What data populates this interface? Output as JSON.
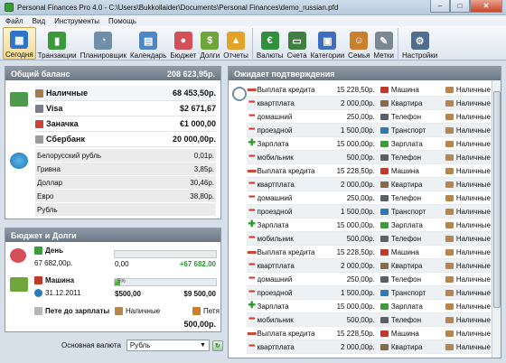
{
  "window": {
    "title": "Personal Finances Pro 4.0 - C:\\Users\\Bukkollaider\\Documents\\Personal Finances\\demo_russian.pfd"
  },
  "menu": [
    "Файл",
    "Вид",
    "Инструменты",
    "Помощь"
  ],
  "toolbar": [
    {
      "label": "Сегодня",
      "icon": "calendar-today-icon",
      "color": "#2f74c8"
    },
    {
      "label": "Транзакции",
      "icon": "book-icon",
      "color": "#3c9a3c"
    },
    {
      "label": "Планировщик",
      "icon": "clock-icon",
      "color": "#6f8fa8"
    },
    {
      "label": "Календарь",
      "icon": "calendar-icon",
      "color": "#4b86c6"
    },
    {
      "label": "Бюджет",
      "icon": "piggy-bank-icon",
      "color": "#d44f57"
    },
    {
      "label": "Долги",
      "icon": "money-stack-icon",
      "color": "#6fa63a"
    },
    {
      "label": "Отчеты",
      "icon": "chart-icon",
      "color": "#e3a228"
    },
    {
      "label": "Валюты",
      "icon": "currency-exchange-icon",
      "color": "#2f8f3a"
    },
    {
      "label": "Счета",
      "icon": "accounts-icon",
      "color": "#3f7f3f"
    },
    {
      "label": "Категории",
      "icon": "categories-icon",
      "color": "#3d6fc0"
    },
    {
      "label": "Семья",
      "icon": "family-icon",
      "color": "#c9802c"
    },
    {
      "label": "Метки",
      "icon": "tags-icon",
      "color": "#7c8794"
    },
    {
      "label": "Настройки",
      "icon": "settings-icon",
      "color": "#4f6d8f"
    }
  ],
  "balance": {
    "title": "Общий баланс",
    "total": "208 623,95р.",
    "accounts": [
      {
        "name": "Наличные",
        "value": "68 453,50р.",
        "color": "#a67a4a"
      },
      {
        "name": "Visa",
        "value": "$2 671,67",
        "color": "#7a7f87"
      },
      {
        "name": "Заначка",
        "value": "€1 000,00",
        "color": "#c9443a"
      },
      {
        "name": "Сбербанк",
        "value": "20 000,00р.",
        "color": "#9a9a9a"
      }
    ],
    "currencies": [
      {
        "name": "Белорусский рубль",
        "value": "0,01р."
      },
      {
        "name": "Гривна",
        "value": "3,85р."
      },
      {
        "name": "Доллар",
        "value": "30,46р."
      },
      {
        "name": "Евро",
        "value": "38,80р."
      },
      {
        "name": "Рубль",
        "value": ""
      }
    ]
  },
  "budget": {
    "title": "Бюджет и Долги",
    "day": {
      "label": "День",
      "amount": "67 682,00р.",
      "spent": "0,00",
      "remaining": "+67 682,00",
      "progress": 0
    },
    "car": {
      "label": "Машина",
      "date": "31.12.2011",
      "progress_text": "5%",
      "progress": 0.05,
      "current": "$500,00",
      "target": "$9 500,00"
    },
    "debt": {
      "label": "Пете до зарплаты",
      "account": "Наличные",
      "person": "Петя",
      "amount": "500,00р."
    }
  },
  "bottom": {
    "label": "Основная валюта",
    "currency": "Рубль"
  },
  "pending": {
    "title": "Ожидает подтверждения",
    "rows": [
      {
        "type": "credit",
        "name": "Выплата кредита",
        "amount": "15 228,50р.",
        "account": "Машина",
        "payment": "Наличные"
      },
      {
        "type": "minus",
        "name": "квартплата",
        "amount": "2 000,00р.",
        "account": "Квартира",
        "payment": "Наличные"
      },
      {
        "type": "minus",
        "name": "домашний",
        "amount": "250,00р.",
        "account": "Телефон",
        "payment": "Наличные"
      },
      {
        "type": "minus",
        "name": "проездной",
        "amount": "1 500,00р.",
        "account": "Транспорт",
        "payment": "Наличные"
      },
      {
        "type": "plus",
        "name": "Зарплата",
        "amount": "15 000,00р.",
        "account": "Зарплата",
        "payment": "Наличные"
      },
      {
        "type": "minus",
        "name": "мобильник",
        "amount": "500,00р.",
        "account": "Телефон",
        "payment": "Наличные"
      },
      {
        "type": "credit",
        "name": "Выплата кредита",
        "amount": "15 228,50р.",
        "account": "Машина",
        "payment": "Наличные"
      },
      {
        "type": "minus",
        "name": "квартплата",
        "amount": "2 000,00р.",
        "account": "Квартира",
        "payment": "Наличные"
      },
      {
        "type": "minus",
        "name": "домашний",
        "amount": "250,00р.",
        "account": "Телефон",
        "payment": "Наличные"
      },
      {
        "type": "minus",
        "name": "проездной",
        "amount": "1 500,00р.",
        "account": "Транспорт",
        "payment": "Наличные"
      },
      {
        "type": "plus",
        "name": "Зарплата",
        "amount": "15 000,00р.",
        "account": "Зарплата",
        "payment": "Наличные"
      },
      {
        "type": "minus",
        "name": "мобильник",
        "amount": "500,00р.",
        "account": "Телефон",
        "payment": "Наличные"
      },
      {
        "type": "credit",
        "name": "Выплата кредита",
        "amount": "15 228,50р.",
        "account": "Машина",
        "payment": "Наличные"
      },
      {
        "type": "minus",
        "name": "квартплата",
        "amount": "2 000,00р.",
        "account": "Квартира",
        "payment": "Наличные"
      },
      {
        "type": "minus",
        "name": "домашний",
        "amount": "250,00р.",
        "account": "Телефон",
        "payment": "Наличные"
      },
      {
        "type": "minus",
        "name": "проездной",
        "amount": "1 500,00р.",
        "account": "Транспорт",
        "payment": "Наличные"
      },
      {
        "type": "plus",
        "name": "Зарплата",
        "amount": "15 000,00р.",
        "account": "Зарплата",
        "payment": "Наличные"
      },
      {
        "type": "minus",
        "name": "мобильник",
        "amount": "500,00р.",
        "account": "Телефон",
        "payment": "Наличные"
      },
      {
        "type": "credit",
        "name": "Выплата кредита",
        "amount": "15 228,50р.",
        "account": "Машина",
        "payment": "Наличные"
      },
      {
        "type": "minus",
        "name": "квартплата",
        "amount": "2 000,00р.",
        "account": "Квартира",
        "payment": "Наличные"
      }
    ]
  },
  "colors": {
    "account_icons": {
      "Машина": "#c0392b",
      "Квартира": "#8a6a44",
      "Телефон": "#5b5f66",
      "Транспорт": "#2e7ab8",
      "Зарплата": "#3f9a3a"
    },
    "payment_icon": "#b6864d",
    "plus": "#2e9a2e",
    "minus": "#d33b2f",
    "credit": "#c94a3b"
  }
}
